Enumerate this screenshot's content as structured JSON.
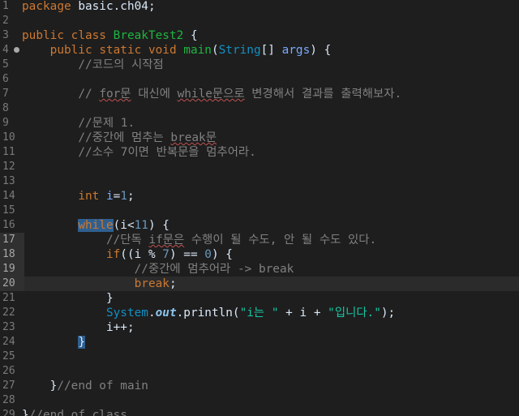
{
  "editor": {
    "lines": [
      {
        "num": "1",
        "segments": [
          {
            "c": "kw",
            "t": "package"
          },
          {
            "c": "",
            "t": " basic.ch04;"
          }
        ]
      },
      {
        "num": "2",
        "segments": []
      },
      {
        "num": "3",
        "segments": [
          {
            "c": "kw",
            "t": "public"
          },
          {
            "c": "",
            "t": " "
          },
          {
            "c": "kw",
            "t": "class"
          },
          {
            "c": "",
            "t": " "
          },
          {
            "c": "cls",
            "t": "BreakTest2"
          },
          {
            "c": "",
            "t": " {"
          }
        ]
      },
      {
        "num": "4",
        "fold": true,
        "segments": [
          {
            "c": "",
            "t": "    "
          },
          {
            "c": "kw",
            "t": "public"
          },
          {
            "c": "",
            "t": " "
          },
          {
            "c": "kw",
            "t": "static"
          },
          {
            "c": "",
            "t": " "
          },
          {
            "c": "kw",
            "t": "void"
          },
          {
            "c": "",
            "t": " "
          },
          {
            "c": "fn",
            "t": "main"
          },
          {
            "c": "",
            "t": "("
          },
          {
            "c": "type",
            "t": "String"
          },
          {
            "c": "",
            "t": "[] "
          },
          {
            "c": "param",
            "t": "args"
          },
          {
            "c": "",
            "t": ") {"
          }
        ]
      },
      {
        "num": "5",
        "segments": [
          {
            "c": "",
            "t": "        "
          },
          {
            "c": "cm",
            "t": "//코드의 시작점"
          }
        ]
      },
      {
        "num": "6",
        "segments": []
      },
      {
        "num": "7",
        "segments": [
          {
            "c": "",
            "t": "        "
          },
          {
            "c": "cm",
            "t": "// "
          },
          {
            "c": "cm warn",
            "t": "for문"
          },
          {
            "c": "cm",
            "t": " 대신에 "
          },
          {
            "c": "cm warn",
            "t": "while문으로"
          },
          {
            "c": "cm",
            "t": " 변경해서 결과를 출력해보자."
          }
        ]
      },
      {
        "num": "8",
        "segments": []
      },
      {
        "num": "9",
        "segments": [
          {
            "c": "",
            "t": "        "
          },
          {
            "c": "cm",
            "t": "//문제 1."
          }
        ]
      },
      {
        "num": "10",
        "segments": [
          {
            "c": "",
            "t": "        "
          },
          {
            "c": "cm",
            "t": "//중간에 멈추는 "
          },
          {
            "c": "cm warn",
            "t": "break문"
          }
        ]
      },
      {
        "num": "11",
        "segments": [
          {
            "c": "",
            "t": "        "
          },
          {
            "c": "cm",
            "t": "//소수 7이면 반복문을 멈추어라."
          }
        ]
      },
      {
        "num": "12",
        "segments": []
      },
      {
        "num": "13",
        "segments": []
      },
      {
        "num": "14",
        "segments": [
          {
            "c": "",
            "t": "        "
          },
          {
            "c": "kw",
            "t": "int"
          },
          {
            "c": "",
            "t": " "
          },
          {
            "c": "param",
            "t": "i"
          },
          {
            "c": "",
            "t": "="
          },
          {
            "c": "num",
            "t": "1"
          },
          {
            "c": "",
            "t": ";"
          }
        ]
      },
      {
        "num": "15",
        "segments": []
      },
      {
        "num": "16",
        "segments": [
          {
            "c": "",
            "t": "        "
          },
          {
            "c": "kw kwsel",
            "t": "while"
          },
          {
            "c": "",
            "t": "(i<"
          },
          {
            "c": "num",
            "t": "11"
          },
          {
            "c": "",
            "t": ") {"
          }
        ]
      },
      {
        "num": "17",
        "hl": true,
        "segments": [
          {
            "c": "",
            "t": "            "
          },
          {
            "c": "cm",
            "t": "//단독 "
          },
          {
            "c": "cm warn",
            "t": "if문은"
          },
          {
            "c": "cm",
            "t": " 수행이 될 수도, 안 될 수도 있다."
          }
        ]
      },
      {
        "num": "18",
        "hl": true,
        "segments": [
          {
            "c": "",
            "t": "            "
          },
          {
            "c": "kw",
            "t": "if"
          },
          {
            "c": "",
            "t": "((i % "
          },
          {
            "c": "num",
            "t": "7"
          },
          {
            "c": "",
            "t": ") == "
          },
          {
            "c": "num",
            "t": "0"
          },
          {
            "c": "",
            "t": ") {"
          }
        ]
      },
      {
        "num": "19",
        "hl": true,
        "segments": [
          {
            "c": "",
            "t": "                "
          },
          {
            "c": "cm",
            "t": "//중간에 멈추어라 -> break"
          }
        ]
      },
      {
        "num": "20",
        "hl": true,
        "current": true,
        "segments": [
          {
            "c": "",
            "t": "                "
          },
          {
            "c": "kw",
            "t": "break"
          },
          {
            "c": "",
            "t": ";"
          }
        ]
      },
      {
        "num": "21",
        "segments": [
          {
            "c": "",
            "t": "            }"
          }
        ]
      },
      {
        "num": "22",
        "segments": [
          {
            "c": "",
            "t": "            "
          },
          {
            "c": "sys",
            "t": "System"
          },
          {
            "c": "",
            "t": "."
          },
          {
            "c": "field",
            "t": "out"
          },
          {
            "c": "",
            "t": ".println("
          },
          {
            "c": "str",
            "t": "\"i는 \""
          },
          {
            "c": "",
            "t": " + i + "
          },
          {
            "c": "str",
            "t": "\"입니다.\""
          },
          {
            "c": "",
            "t": ");"
          }
        ]
      },
      {
        "num": "23",
        "segments": [
          {
            "c": "",
            "t": "            i++;"
          }
        ]
      },
      {
        "num": "24",
        "segments": [
          {
            "c": "",
            "t": "        "
          },
          {
            "c": "sel",
            "t": "}"
          }
        ]
      },
      {
        "num": "25",
        "segments": []
      },
      {
        "num": "26",
        "segments": []
      },
      {
        "num": "27",
        "segments": [
          {
            "c": "",
            "t": "    }"
          },
          {
            "c": "cm",
            "t": "//end of main"
          }
        ]
      },
      {
        "num": "28",
        "segments": []
      },
      {
        "num": "29",
        "segments": [
          {
            "c": "",
            "t": "}"
          },
          {
            "c": "cm",
            "t": "//end of class"
          }
        ]
      }
    ]
  }
}
